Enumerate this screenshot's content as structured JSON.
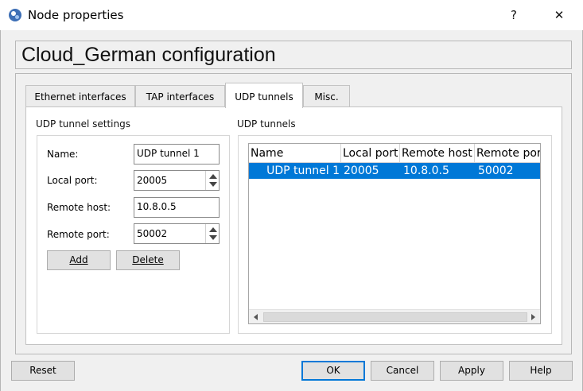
{
  "window": {
    "title": "Node properties",
    "help_glyph": "?",
    "close_glyph": "✕"
  },
  "header": {
    "title": "Cloud_German configuration"
  },
  "tabs": [
    {
      "label": "Ethernet interfaces",
      "active": false
    },
    {
      "label": "TAP interfaces",
      "active": false
    },
    {
      "label": "UDP tunnels",
      "active": true
    },
    {
      "label": "Misc.",
      "active": false
    }
  ],
  "settings": {
    "group_title": "UDP tunnel settings",
    "name_label": "Name:",
    "name_value": "UDP tunnel 1",
    "local_port_label": "Local port:",
    "local_port_value": "20005",
    "remote_host_label": "Remote host:",
    "remote_host_value": "10.8.0.5",
    "remote_port_label": "Remote port:",
    "remote_port_value": "50002",
    "add_label": "Add",
    "delete_label": "Delete"
  },
  "tunnels": {
    "group_title": "UDP tunnels",
    "columns": [
      "Name",
      "Local port",
      "Remote host",
      "Remote por"
    ],
    "rows": [
      {
        "name": "UDP tunnel 1",
        "local_port": "20005",
        "remote_host": "10.8.0.5",
        "remote_port": "50002",
        "selected": true
      }
    ]
  },
  "footer": {
    "reset_label": "Reset",
    "ok_label": "OK",
    "cancel_label": "Cancel",
    "apply_label": "Apply",
    "help_label": "Help"
  },
  "colors": {
    "selection": "#0078d7",
    "default_button_border": "#0078d7",
    "window_bg": "#f0f0f0"
  }
}
